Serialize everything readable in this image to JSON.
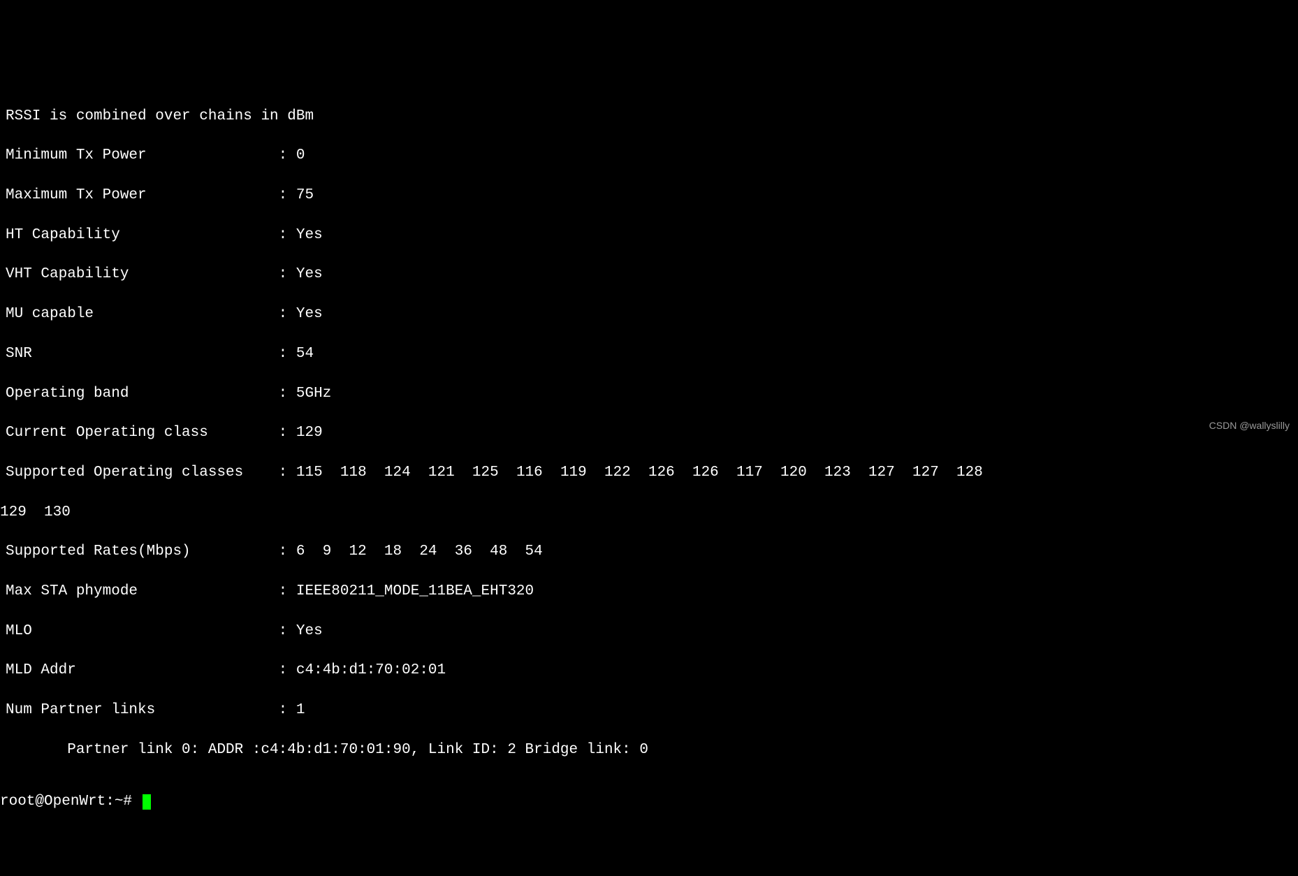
{
  "header_line": "RSSI is combined over chains in dBm",
  "fields": {
    "min_tx_power": {
      "label": "Minimum Tx Power",
      "value": "0"
    },
    "max_tx_power": {
      "label": "Maximum Tx Power",
      "value": "75"
    },
    "ht_capability": {
      "label": "HT Capability",
      "value": "Yes"
    },
    "vht_capability": {
      "label": "VHT Capability",
      "value": "Yes"
    },
    "mu_capable": {
      "label": "MU capable",
      "value": "Yes"
    },
    "snr": {
      "label": "SNR",
      "value": "54"
    },
    "operating_band": {
      "label": "Operating band",
      "value": "5GHz"
    },
    "current_operating_class": {
      "label": "Current Operating class",
      "value": "129"
    },
    "supported_operating_classes": {
      "label": "Supported Operating classes",
      "value_line1": "115  118  124  121  125  116  119  122  126  126  117  120  123  127  127  128",
      "value_line2": "129  130"
    },
    "supported_rates": {
      "label": "Supported Rates(Mbps)",
      "value": "6  9  12  18  24  36  48  54"
    },
    "max_sta_phymode": {
      "label": "Max STA phymode",
      "value": "IEEE80211_MODE_11BEA_EHT320"
    },
    "mlo": {
      "label": "MLO",
      "value": "Yes"
    },
    "mld_addr": {
      "label": "MLD Addr",
      "value": "c4:4b:d1:70:02:01"
    },
    "num_partner_links": {
      "label": "Num Partner links",
      "value": "1"
    }
  },
  "partner_link_line": "       Partner link 0: ADDR :c4:4b:d1:70:01:90, Link ID: 2 Bridge link: 0",
  "prompt": "root@OpenWrt:~# ",
  "watermark": "CSDN @wallyslilly"
}
